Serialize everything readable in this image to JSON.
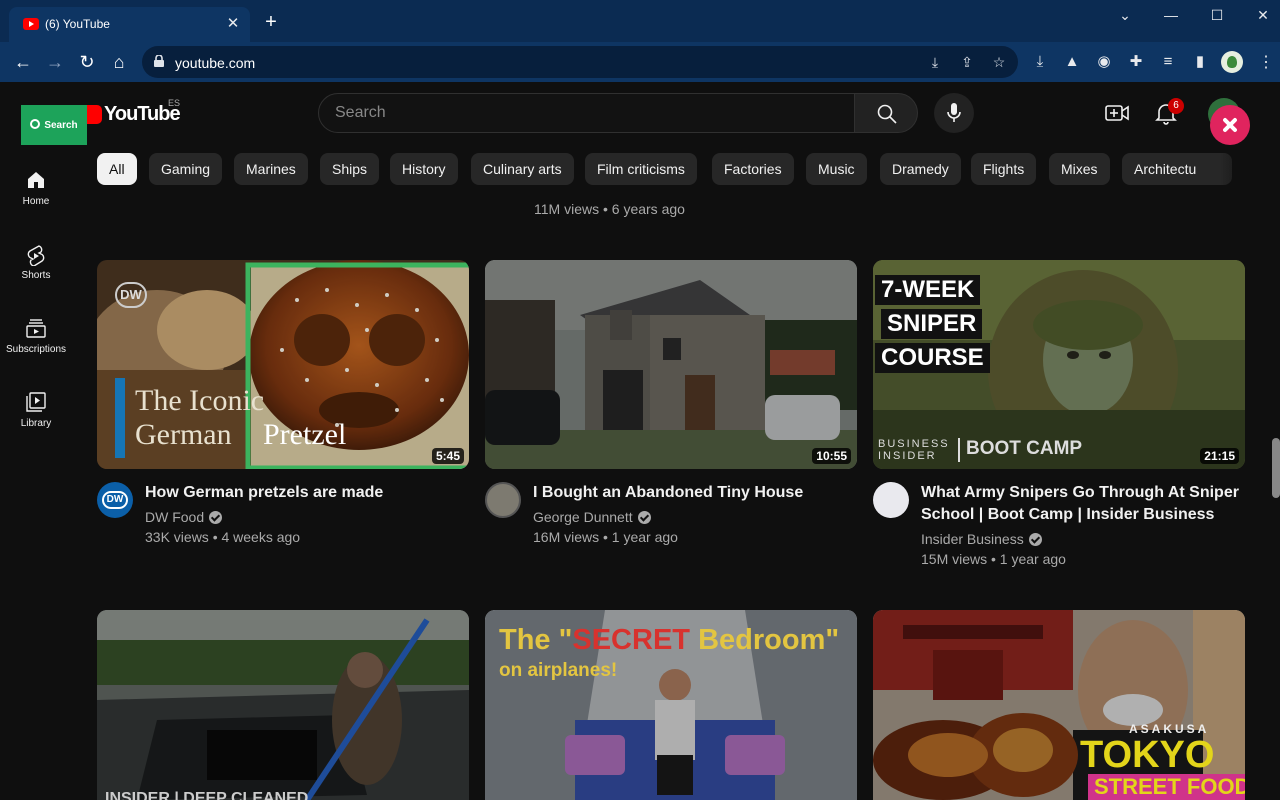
{
  "browser": {
    "tab_title": "(6) YouTube",
    "url": "youtube.com"
  },
  "masthead": {
    "logo_text": "YouTube",
    "region": "ES",
    "search_placeholder": "Search",
    "notification_count": "6",
    "overlay_search_label": "Search"
  },
  "sidebar": {
    "items": [
      {
        "label": "Home",
        "icon": "home-icon"
      },
      {
        "label": "Shorts",
        "icon": "shorts-icon"
      },
      {
        "label": "Subscriptions",
        "icon": "subscriptions-icon"
      },
      {
        "label": "Library",
        "icon": "library-icon"
      }
    ]
  },
  "chips": [
    "All",
    "Gaming",
    "Marines",
    "Ships",
    "History",
    "Culinary arts",
    "Film criticisms",
    "Factories",
    "Music",
    "Dramedy",
    "Flights",
    "Mixes",
    "Architectu"
  ],
  "previous_row_meta": "11M views • 6 years ago",
  "videos": [
    {
      "title": "How German pretzels are made",
      "channel": "DW Food",
      "meta": "33K views • 4 weeks ago",
      "duration": "5:45",
      "thumb_text_a": "The Iconic",
      "thumb_text_b": "German",
      "thumb_text_c": "Pretzel",
      "thumb_logo": "DW"
    },
    {
      "title": "I Bought an Abandoned Tiny House",
      "channel": "George Dunnett",
      "meta": "16M views • 1 year ago",
      "duration": "10:55"
    },
    {
      "title": "What Army Snipers Go Through At Sniper School | Boot Camp | Insider Business",
      "channel": "Insider Business",
      "meta": "15M views • 1 year ago",
      "duration": "21:15",
      "thumb_line1": "7-WEEK",
      "thumb_line2": "SNIPER",
      "thumb_line3": "COURSE",
      "thumb_brand_a": "BUSINESS",
      "thumb_brand_b": "INSIDER",
      "thumb_brand_c": "BOOT CAMP"
    }
  ],
  "row2": {
    "thumb2_title_a": "The \"",
    "thumb2_title_b": "SECRET",
    "thumb2_title_c": " Bedroom\"",
    "thumb2_sub": "on airplanes!",
    "thumb3_a": "ASAKUSA",
    "thumb3_b": "TOKYO",
    "thumb3_c": "STREET FOOD",
    "thumb1_caption": "INSIDER | DEEP CLEANED"
  },
  "colors": {
    "overlay_search_bg": "#1da35a",
    "overlay_close_bg": "#e0245e",
    "highlight_border": "#47d36f",
    "brand_red": "#ff0000"
  }
}
